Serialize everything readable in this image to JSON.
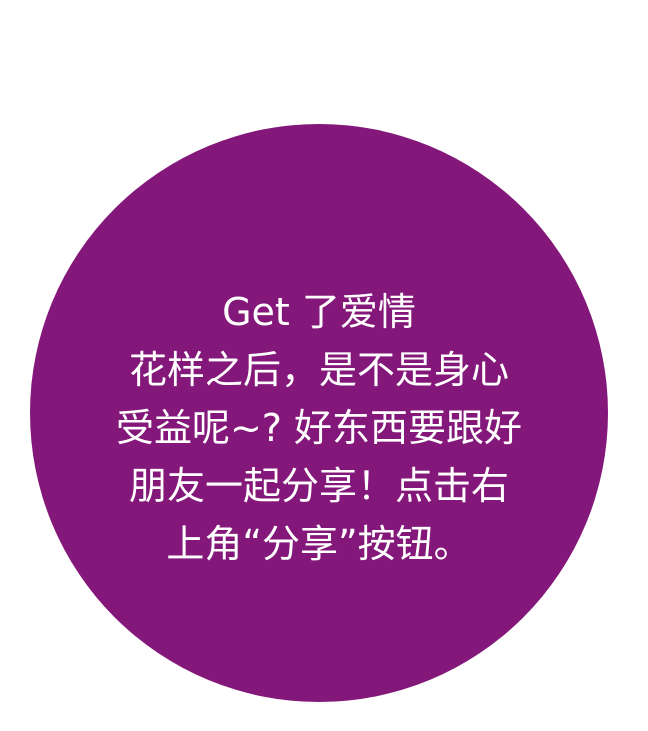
{
  "colors": {
    "circle": "#84187a",
    "text": "#ffffff",
    "background": "#ffffff"
  },
  "message": {
    "lines": [
      "Get 了爱情",
      "花样之后，是不是身心",
      "受益呢~? 好东西要跟好",
      "朋友一起分享！点击右",
      "上角“分享”按钮。"
    ]
  }
}
